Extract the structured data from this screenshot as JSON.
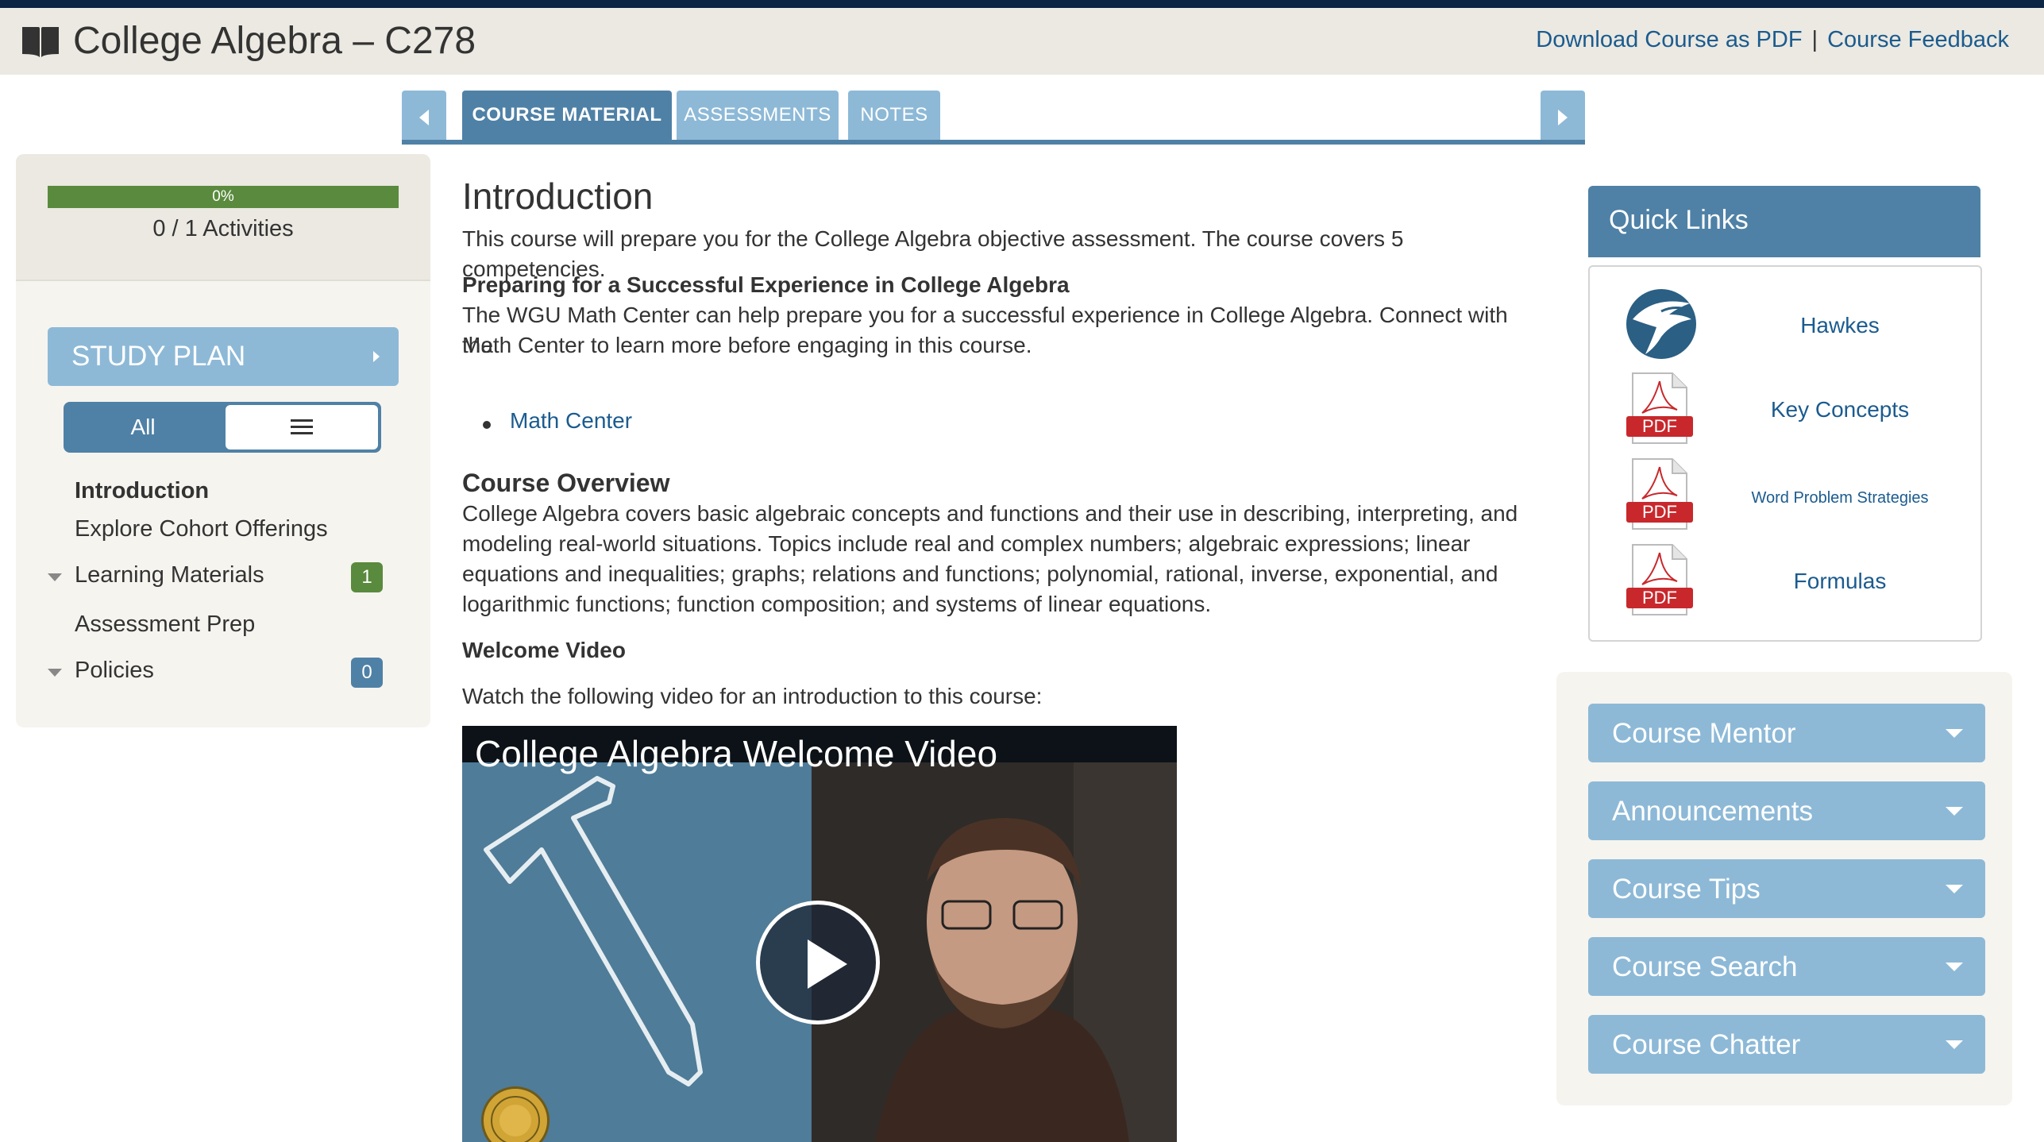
{
  "header": {
    "title": "College Algebra – C278",
    "download_link": "Download Course as PDF",
    "separator": "|",
    "feedback_link": "Course Feedback"
  },
  "tabs": [
    {
      "label": "COURSE MATERIAL",
      "active": true
    },
    {
      "label": "ASSESSMENTS",
      "active": false
    },
    {
      "label": "NOTES",
      "active": false
    }
  ],
  "sidebar": {
    "progress_percent": 0,
    "progress_label": "0%",
    "activities": "0 / 1 Activities",
    "study_plan": "STUDY PLAN",
    "toggle_all": "All",
    "items": [
      {
        "label": "Introduction",
        "bold": true
      },
      {
        "label": "Explore Cohort Offerings"
      },
      {
        "label": "Learning Materials",
        "badge": "1",
        "badge_color": "#5a8a3e",
        "expandable": true
      },
      {
        "label": "Assessment Prep"
      },
      {
        "label": "Policies",
        "badge": "0",
        "badge_color": "#4f81a6",
        "expandable": true
      }
    ]
  },
  "main": {
    "heading": "Introduction",
    "intro": "This course will prepare you for the College Algebra objective assessment. The course covers 5 competencies.",
    "prep_heading": "Preparing for a Successful Experience in College Algebra",
    "prep_line1": "The WGU Math Center can help prepare you for a successful experience in College Algebra. Connect with the",
    "prep_line2": "Math Center to learn more before engaging in this course.",
    "math_center_link": "Math Center",
    "overview_heading": "Course Overview",
    "overview_lines": [
      "College Algebra covers basic algebraic concepts and functions and their use in describing, interpreting, and",
      "modeling real-world situations. Topics include real and complex numbers; algebraic expressions; linear",
      "equations and inequalities; graphs; relations and functions; polynomial, rational, inverse, exponential, and",
      "logarithmic functions; function composition; and systems of linear equations."
    ],
    "welcome_heading": "Welcome Video",
    "welcome_text": "Watch the following video for an introduction to this course:",
    "video_title": "College Algebra Welcome Video"
  },
  "quick_links": {
    "title": "Quick Links",
    "items": [
      {
        "label": "Hawkes",
        "icon": "hawk-logo-icon"
      },
      {
        "label": "Key Concepts",
        "icon": "pdf-icon"
      },
      {
        "label": "Word Problem Strategies",
        "icon": "pdf-icon"
      },
      {
        "label": "Formulas",
        "icon": "pdf-icon"
      }
    ],
    "pdf_text": "PDF"
  },
  "accordions": [
    "Course Mentor",
    "Announcements",
    "Course Tips",
    "Course Search",
    "Course Chatter"
  ],
  "colors": {
    "navy": "#0b2542",
    "accent": "#4f81a6",
    "light_accent": "#8db9d7",
    "link": "#1b5b8f",
    "green": "#5a8a3e",
    "pdf_red": "#c8282c"
  }
}
